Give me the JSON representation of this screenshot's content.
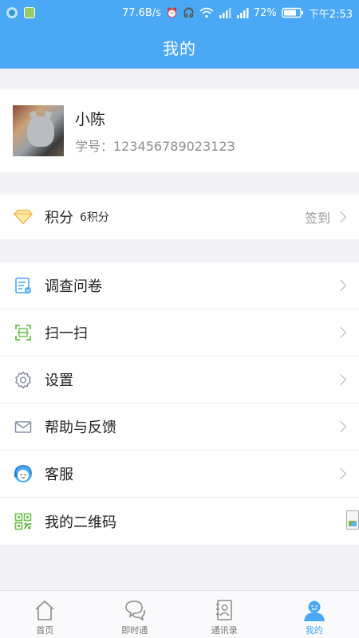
{
  "status_bar": {
    "speed": "77.6B/s",
    "battery": "72%",
    "time": "下午2:53"
  },
  "header": {
    "title": "我的"
  },
  "profile": {
    "name": "小陈",
    "student_id": "学号：12345678902312З"
  },
  "points": {
    "label": "积分",
    "value": "6积分",
    "action": "签到"
  },
  "menu": {
    "items": [
      {
        "label": "调查问卷",
        "icon": "survey-icon"
      },
      {
        "label": "扫一扫",
        "icon": "scan-icon"
      },
      {
        "label": "设置",
        "icon": "settings-gear-icon"
      },
      {
        "label": "帮助与反馈",
        "icon": "mail-icon"
      },
      {
        "label": "客服",
        "icon": "customer-service-icon"
      },
      {
        "label": "我的二维码",
        "icon": "qr-code-icon"
      }
    ]
  },
  "tabbar": {
    "items": [
      {
        "label": "首页",
        "icon": "home-icon"
      },
      {
        "label": "即时通",
        "icon": "chat-icon"
      },
      {
        "label": "通讯录",
        "icon": "contacts-icon"
      },
      {
        "label": "我的",
        "icon": "user-icon"
      }
    ],
    "active": "我的"
  },
  "colors": {
    "primary": "#4aa8f4",
    "background": "#f3f2f6",
    "text": "#222222",
    "muted": "#9b9b9b"
  }
}
